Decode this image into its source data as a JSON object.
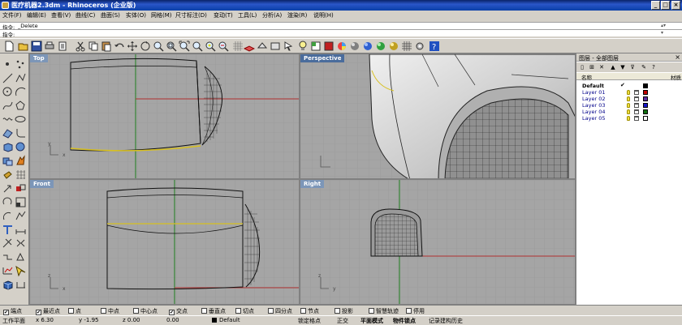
{
  "window": {
    "title": "医疗机器2.3dm - Rhinoceros (企业版)",
    "buttons": {
      "minimize": "_",
      "maximize": "□",
      "close": "×"
    }
  },
  "menu": [
    "文件(F)",
    "编辑(E)",
    "查看(V)",
    "曲线(C)",
    "曲面(S)",
    "实体(O)",
    "网格(M)",
    "尺寸标注(D)",
    "变动(T)",
    "工具(L)",
    "分析(A)",
    "渲染(R)",
    "说明(H)"
  ],
  "command": {
    "history_label": "指令:",
    "history_text": "_Delete",
    "prompt_label": "指令:",
    "prompt_text": ""
  },
  "viewports": {
    "top": "Top",
    "perspective": "Perspective",
    "front": "Front",
    "right": "Right"
  },
  "layers": {
    "panel_title": "图层 - 全部图层",
    "col_name": "名称",
    "col_material": "材质",
    "rows": [
      {
        "name": "Default",
        "current": "✔",
        "color": "#000000"
      },
      {
        "name": "Layer 01",
        "current": "",
        "color": "#c00000"
      },
      {
        "name": "Layer 02",
        "current": "",
        "color": "#5c2ca0"
      },
      {
        "name": "Layer 03",
        "current": "",
        "color": "#1818c8"
      },
      {
        "name": "Layer 04",
        "current": "",
        "color": "#107010"
      },
      {
        "name": "Layer 05",
        "current": "",
        "color": "#ffffff"
      }
    ]
  },
  "osnaps": [
    {
      "label": "端点",
      "checked": true
    },
    {
      "label": "最近点",
      "checked": true
    },
    {
      "label": "点",
      "checked": false
    },
    {
      "label": "中点",
      "checked": false
    },
    {
      "label": "中心点",
      "checked": false
    },
    {
      "label": "交点",
      "checked": true
    },
    {
      "label": "垂直点",
      "checked": false
    },
    {
      "label": "切点",
      "checked": false
    },
    {
      "label": "四分点",
      "checked": false
    },
    {
      "label": "节点",
      "checked": false
    },
    {
      "label": "投影",
      "checked": false
    },
    {
      "label": "智慧轨迹",
      "checked": false
    },
    {
      "label": "停用",
      "checked": false
    }
  ],
  "status": {
    "cplane": "工作平面",
    "x": "x 6.30",
    "y": "y -1.95",
    "z": "z 0.00",
    "dist": "0.00",
    "layer": "Default",
    "grid_snap": "锁定格点",
    "ortho": "正交",
    "planar": "平面模式",
    "object_snap": "物件锁点",
    "history": "记录建构历史"
  },
  "colors": {
    "viewport_bg": "#a5a5a5",
    "grid": "#959595",
    "x_axis": "#b03030",
    "y_axis": "#208020",
    "title_bar": "#0a246a"
  }
}
